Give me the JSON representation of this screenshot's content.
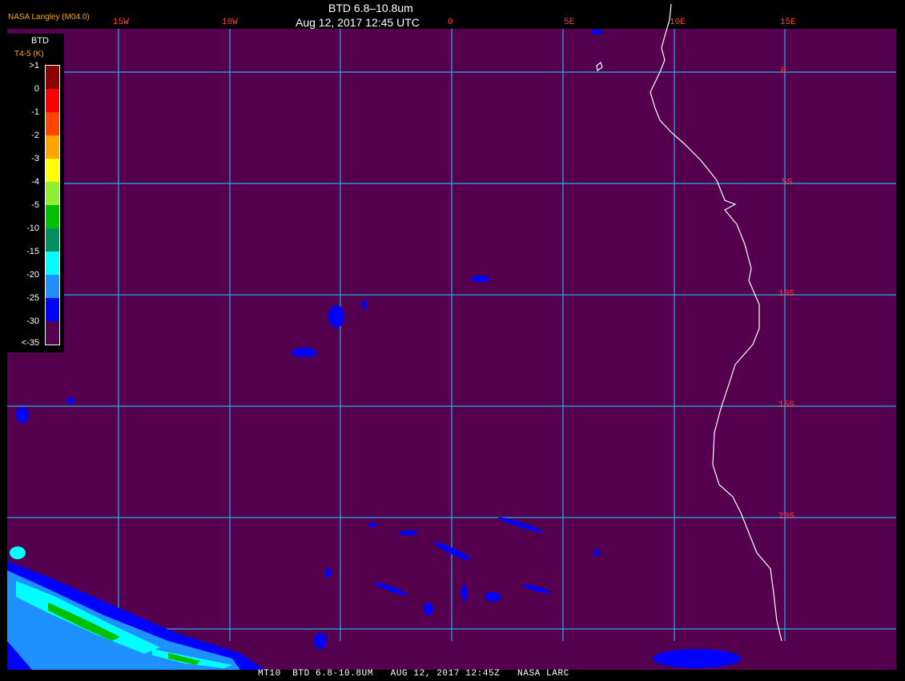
{
  "header": {
    "title": "BTD 6.8–10.8um",
    "datetime": "Aug 12, 2017 12:45 UTC",
    "organization": "NASA Langley (M04.0)"
  },
  "map": {
    "background_color": "#55004f",
    "grid_color": "#20b0e0",
    "coastline_color": "#ffffff",
    "longitude_labels": [
      "15W",
      "10W",
      "0",
      "5E",
      "10E",
      "15E"
    ],
    "latitude_labels": [
      "0",
      "5S",
      "10S",
      "15S",
      "20S"
    ]
  },
  "legend": {
    "title": "BTD",
    "subtitle": "T4-5 (K)",
    "labels": [
      ">1",
      "0",
      "-1",
      "-2",
      "-3",
      "-4",
      "-5",
      "-10",
      "-15",
      "-20",
      "-25",
      "-30",
      "<-35"
    ],
    "colors": [
      "#8b0000",
      "#ff0000",
      "#ff4500",
      "#ffa500",
      "#ffff00",
      "#90ee30",
      "#00c000",
      "#009060",
      "#00ffff",
      "#1e90ff",
      "#0000ff",
      "#55004f"
    ]
  },
  "footer": {
    "text": "MT10  BTD 6.8-10.8UM   AUG 12, 2017 12:45Z   NASA LARC"
  }
}
